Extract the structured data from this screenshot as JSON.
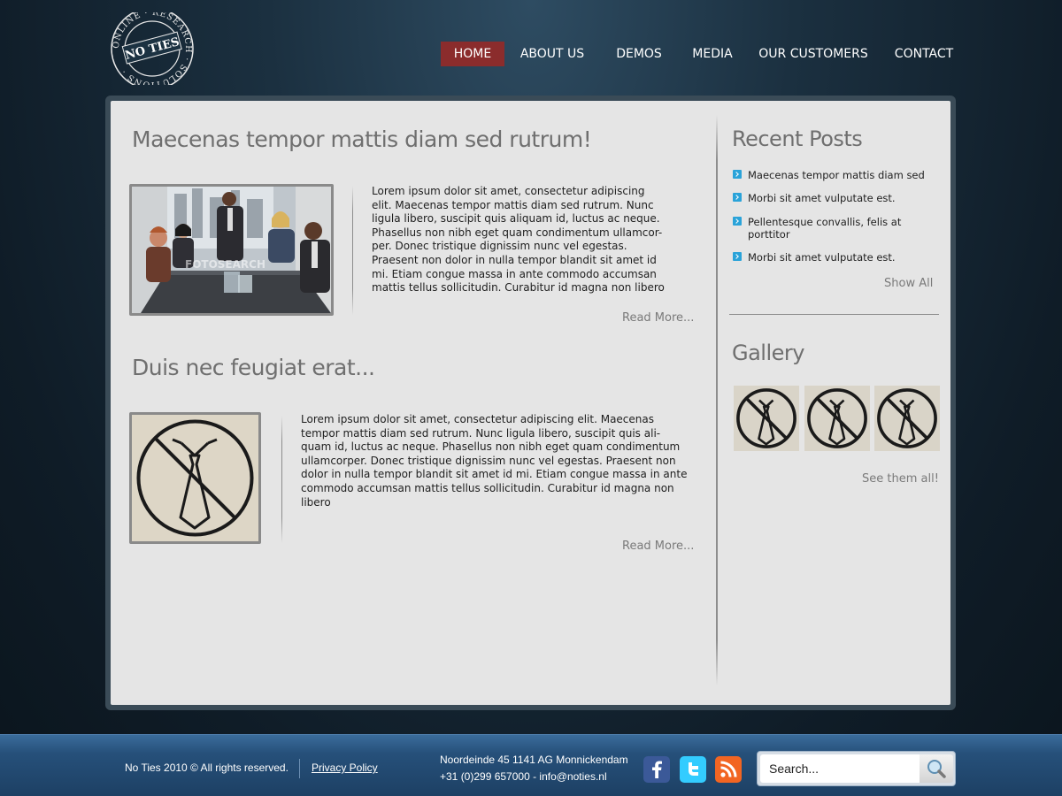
{
  "logo": {
    "center_text": "NO TIES",
    "ring_text": "ONLINE · RESEARCH · SOLUTIONS ·"
  },
  "nav": {
    "items": [
      {
        "label": "HOME",
        "active": true
      },
      {
        "label": "ABOUT US",
        "active": false
      },
      {
        "label": "DEMOS",
        "active": false
      },
      {
        "label": "MEDIA",
        "active": false
      },
      {
        "label": "OUR CUSTOMERS",
        "active": false
      },
      {
        "label": "CONTACT",
        "active": false
      }
    ],
    "active_color": "#8b2c2c"
  },
  "posts": [
    {
      "title": "Maecenas tempor mattis diam sed rutrum!",
      "image": "business-meeting-photo",
      "image_watermark": "FOTOSEARCH",
      "body_lines": [
        "Lorem ipsum dolor sit amet, consectetur adipiscing",
        "elit. Maecenas tempor mattis diam sed rutrum. Nunc",
        "ligula libero, suscipit quis aliquam id, luctus ac neque.",
        "Phasellus non nibh eget quam condimentum ullamcor-",
        "per. Donec tristique dignissim nunc vel egestas.",
        "Praesent non dolor in nulla tempor blandit sit amet id",
        "mi. Etiam congue massa in ante commodo accumsan",
        "mattis tellus sollicitudin. Curabitur id magna non libero"
      ],
      "read_more": "Read More..."
    },
    {
      "title": "Duis nec feugiat erat...",
      "image": "no-ties-sign",
      "body_lines": [
        "Lorem ipsum dolor sit amet, consectetur adipiscing elit. Maecenas",
        "tempor mattis diam sed rutrum. Nunc ligula libero, suscipit quis ali-",
        "quam id, luctus ac neque. Phasellus non nibh eget quam condimentum",
        "ullamcorper. Donec tristique dignissim nunc vel egestas. Praesent non",
        "dolor in nulla tempor blandit sit amet id mi. Etiam congue massa in ante",
        "commodo accumsan mattis tellus sollicitudin. Curabitur id magna non",
        "libero"
      ],
      "read_more": "Read More..."
    }
  ],
  "sidebar": {
    "recent_title": "Recent Posts",
    "recent_posts": [
      "Maecenas tempor mattis diam sed",
      "Morbi sit amet vulputate est.",
      "Pellentesque convallis, felis at porttitor",
      "Morbi sit amet vulputate est."
    ],
    "show_all": "Show All",
    "gallery_title": "Gallery",
    "gallery_images": [
      "no-ties-sign",
      "no-ties-sign",
      "no-ties-sign"
    ],
    "see_all": "See them all!",
    "bullet_color": "#2aa3d9"
  },
  "footer": {
    "copyright": "No Ties 2010 © All rights reserved.",
    "privacy": "Privacy Policy",
    "address": "Noordeinde 45 1141 AG Monnickendam",
    "contact": "+31 (0)299 657000 - info@noties.nl",
    "social": [
      {
        "icon": "facebook-icon",
        "color": "#3b5998"
      },
      {
        "icon": "twitter-icon",
        "color": "#33ccff"
      },
      {
        "icon": "rss-icon",
        "color": "#f26522"
      }
    ],
    "search_placeholder": "Search..."
  }
}
